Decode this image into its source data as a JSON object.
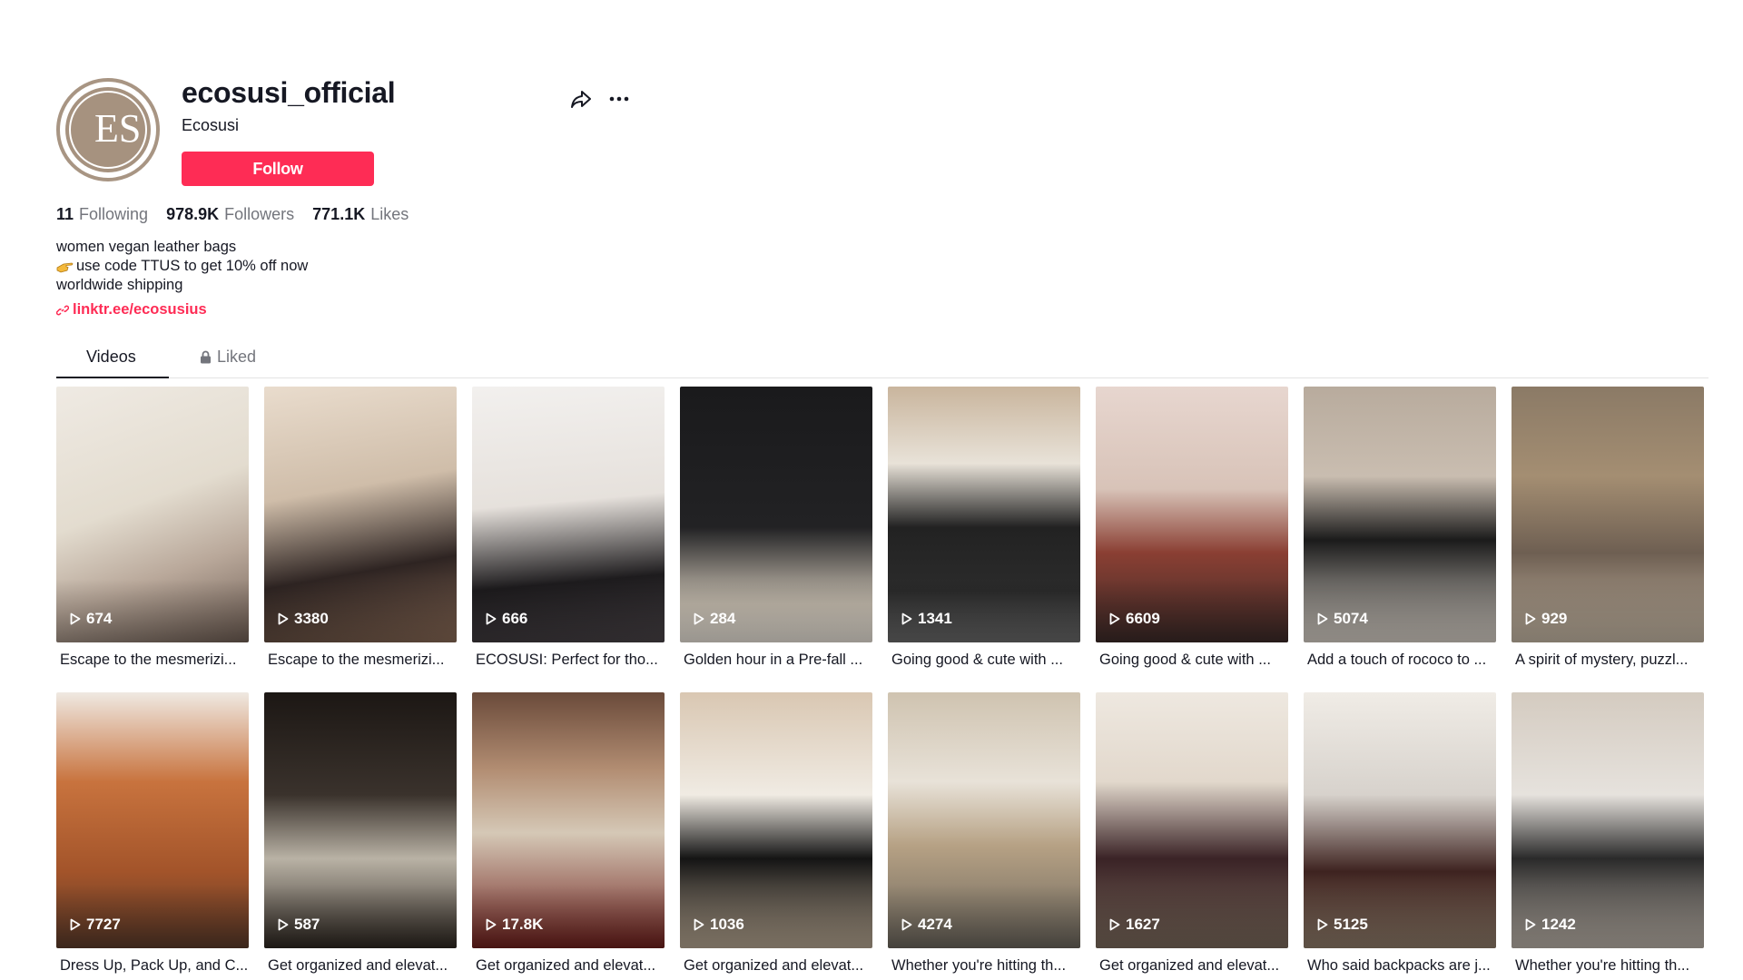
{
  "profile": {
    "username": "ecosusi_official",
    "nickname": "Ecosusi",
    "avatar_letters": "ES",
    "follow_label": "Follow",
    "stats": {
      "following_count": "11",
      "following_label": "Following",
      "followers_count": "978.9K",
      "followers_label": "Followers",
      "likes_count": "771.1K",
      "likes_label": "Likes"
    },
    "bio": [
      "women vegan leather bags",
      "use code TTUS to get 10% off now",
      "worldwide shipping"
    ],
    "link": "linktr.ee/ecosusius"
  },
  "tabs": {
    "videos": "Videos",
    "liked": "Liked"
  },
  "icons": {
    "share": "share-icon",
    "more": "more-icon",
    "lock": "lock-icon",
    "link": "link-icon",
    "play": "play-icon",
    "pointing_hand": "pointing-hand-icon"
  },
  "colors": {
    "accent": "#fe2c55",
    "text": "#161823",
    "secondary": "#73757c"
  },
  "videos": [
    {
      "views": "674",
      "caption": "Escape to the mesmerizi..."
    },
    {
      "views": "3380",
      "caption": "Escape to the mesmerizi..."
    },
    {
      "views": "666",
      "caption": "ECOSUSI: Perfect for tho..."
    },
    {
      "views": "284",
      "caption": "Golden hour in a Pre-fall ..."
    },
    {
      "views": "1341",
      "caption": "Going good & cute with ..."
    },
    {
      "views": "6609",
      "caption": "Going good & cute with ..."
    },
    {
      "views": "5074",
      "caption": "Add a touch of rococo to ..."
    },
    {
      "views": "929",
      "caption": "A spirit of mystery, puzzl..."
    },
    {
      "views": "7727",
      "caption": "Dress Up, Pack Up, and C..."
    },
    {
      "views": "587",
      "caption": "Get organized and elevat..."
    },
    {
      "views": "17.8K",
      "caption": "Get organized and elevat..."
    },
    {
      "views": "1036",
      "caption": "Get organized and elevat..."
    },
    {
      "views": "4274",
      "caption": "Whether you're hitting th..."
    },
    {
      "views": "1627",
      "caption": "Get organized and elevat..."
    },
    {
      "views": "5125",
      "caption": "Who said backpacks are j..."
    },
    {
      "views": "1242",
      "caption": "Whether you're hitting th..."
    }
  ]
}
